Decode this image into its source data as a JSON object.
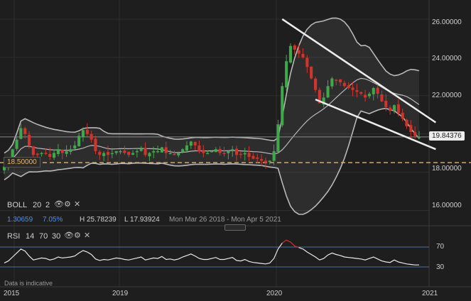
{
  "chart_data": {
    "type": "candlestick",
    "price_axis": {
      "ticks": [
        "26.00000",
        "24.00000",
        "22.00000",
        "18.00000",
        "16.00000"
      ],
      "ylim": [
        15.2,
        27.0
      ]
    },
    "time_axis": {
      "ticks": [
        "2015",
        "2019",
        "2020",
        "2021"
      ],
      "range": [
        "2018-03-26",
        "2021-04-05"
      ]
    },
    "last_price": "19.84376",
    "last_price_value": 19.84376,
    "support_label": "18.50000",
    "support_value": 18.5,
    "series": [
      {
        "name": "Close",
        "values": [
          18.3,
          18.6,
          19.2,
          19.7,
          20.3,
          20.0,
          19.4,
          18.9,
          18.9,
          19.0,
          19.0,
          18.8,
          19.0,
          19.2,
          19.0,
          19.1,
          19.2,
          19.4,
          19.9,
          20.2,
          20.0,
          19.7,
          19.1,
          18.9,
          19.0,
          18.9,
          19.0,
          19.1,
          19.1,
          19.0,
          18.9,
          19.0,
          19.1,
          19.2,
          18.9,
          19.0,
          19.1,
          19.1,
          19.3,
          19.0,
          19.0,
          18.9,
          19.0,
          19.2,
          19.4,
          19.6,
          19.4,
          19.1,
          19.0,
          19.0,
          19.1,
          19.2,
          19.0,
          19.0,
          19.1,
          19.2,
          18.9,
          18.9,
          19.0,
          18.8,
          18.7,
          18.7,
          18.6,
          18.5,
          18.6,
          19.1,
          20.5,
          22.5,
          23.8,
          24.6,
          24.4,
          24.2,
          24.0,
          23.5,
          22.9,
          22.3,
          21.6,
          21.9,
          22.5,
          22.9,
          22.8,
          22.7,
          22.5,
          22.4,
          22.3,
          22.2,
          22.1,
          21.9,
          22.1,
          22.4,
          22.1,
          21.7,
          21.4,
          21.2,
          21.5,
          21.1,
          20.8,
          20.4,
          20.1,
          19.9,
          19.84
        ]
      }
    ],
    "bollinger": {
      "label": "BOLL",
      "period": "20",
      "mult": "2",
      "values": [
        "1.30659",
        "7.05%"
      ],
      "high": "H 25.78239",
      "low": "L 17.93924",
      "range_text": "Mon Mar 26 2018 - Mon Apr 5 2021"
    },
    "rsi": {
      "label": "RSI",
      "period": "14",
      "upper": "70",
      "lower": "30",
      "axis_ticks": [
        "70",
        "30"
      ],
      "values": [
        38,
        42,
        50,
        58,
        66,
        62,
        52,
        44,
        46,
        48,
        47,
        44,
        46,
        50,
        48,
        49,
        50,
        52,
        58,
        63,
        60,
        55,
        46,
        43,
        45,
        44,
        46,
        48,
        47,
        45,
        44,
        46,
        48,
        50,
        44,
        46,
        48,
        47,
        51,
        45,
        46,
        44,
        46,
        50,
        53,
        56,
        52,
        47,
        45,
        45,
        47,
        49,
        45,
        45,
        47,
        49,
        43,
        42,
        45,
        41,
        39,
        38,
        37,
        36,
        38,
        47,
        66,
        78,
        84,
        80,
        72,
        69,
        66,
        60,
        55,
        50,
        44,
        47,
        54,
        58,
        55,
        53,
        50,
        49,
        48,
        47,
        46,
        44,
        47,
        50,
        46,
        42,
        40,
        39,
        44,
        40,
        38,
        36,
        35,
        34,
        34
      ]
    },
    "indicative_note": "Data is indicative"
  },
  "colors": {
    "up": "#3fa84a",
    "down": "#d0342c",
    "band": "#b8b8b8",
    "band_fill": "rgba(255,255,255,0.07)",
    "support": "#e6b36a",
    "trendline": "#ececec",
    "rsi_line": "#e8e8e8",
    "rsi_overbought": "#d0342c",
    "level_line": "#4a6fa5",
    "boll_value1": "#4f8ff0",
    "boll_value2": "#4f8ff0"
  },
  "icons": [
    "eye-icon",
    "gear-icon",
    "close-icon",
    "collapse-icon"
  ]
}
